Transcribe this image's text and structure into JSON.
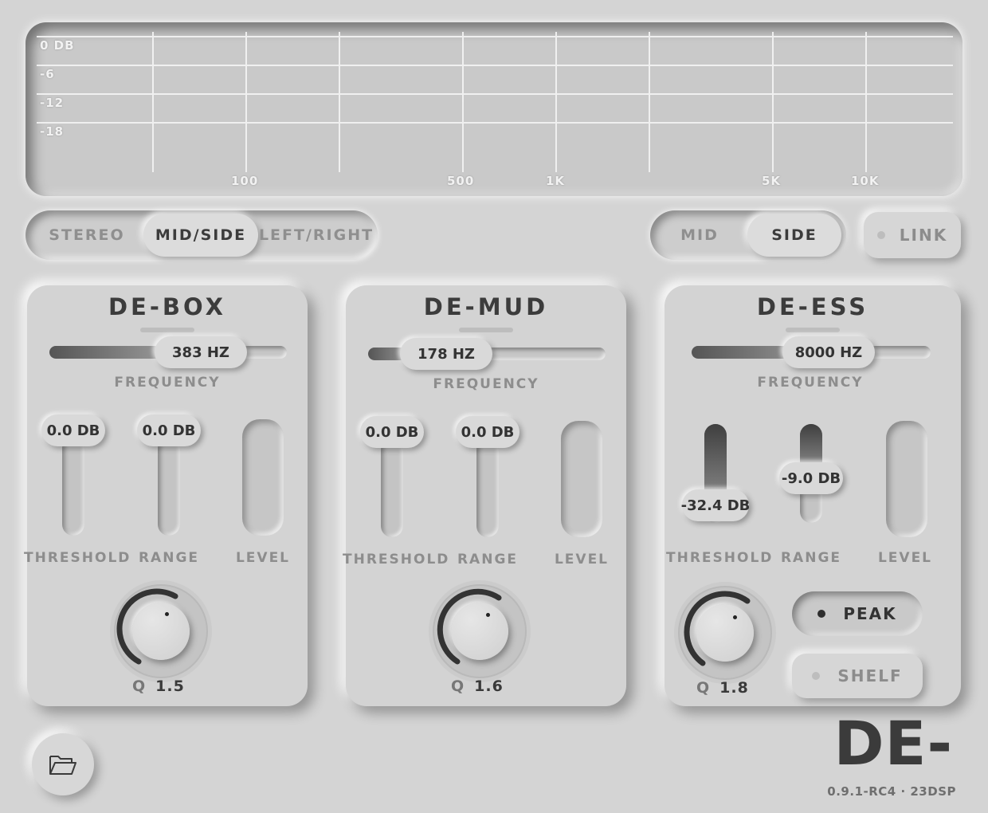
{
  "display": {
    "db_labels": [
      "0 DB",
      "-6",
      "-12",
      "-18"
    ],
    "hz_labels": [
      "100",
      "500",
      "1K",
      "5K",
      "10K"
    ]
  },
  "mode_switch": {
    "options": [
      "STEREO",
      "MID/SIDE",
      "LEFT/RIGHT"
    ],
    "selected": "MID/SIDE"
  },
  "channel_switch": {
    "options": [
      "MID",
      "SIDE"
    ],
    "selected": "SIDE"
  },
  "link": {
    "label": "LINK",
    "active": false
  },
  "modules": [
    {
      "title": "DE-BOX",
      "frequency": {
        "value_label": "383 HZ",
        "label": "FREQUENCY",
        "position": 0.45
      },
      "threshold": {
        "value_label": "0.0 DB",
        "label": "THRESHOLD",
        "level": 0.0
      },
      "range": {
        "value_label": "0.0 DB",
        "label": "RANGE",
        "level": 0.0
      },
      "level_label": "LEVEL",
      "q": {
        "label": "Q",
        "value": "1.5",
        "fraction": 0.5
      }
    },
    {
      "title": "DE-MUD",
      "frequency": {
        "value_label": "178 HZ",
        "label": "FREQUENCY",
        "position": 0.15
      },
      "threshold": {
        "value_label": "0.0 DB",
        "label": "THRESHOLD",
        "level": 0.0
      },
      "range": {
        "value_label": "0.0 DB",
        "label": "RANGE",
        "level": 0.0
      },
      "level_label": "LEVEL",
      "q": {
        "label": "Q",
        "value": "1.6",
        "fraction": 0.55
      }
    },
    {
      "title": "DE-ESS",
      "frequency": {
        "value_label": "8000 HZ",
        "label": "FREQUENCY",
        "position": 0.58
      },
      "threshold": {
        "value_label": "-32.4 DB",
        "label": "THRESHOLD",
        "level": 0.8
      },
      "range": {
        "value_label": "-9.0 DB",
        "label": "RANGE",
        "level": 0.4
      },
      "level_label": "LEVEL",
      "q": {
        "label": "Q",
        "value": "1.8",
        "fraction": 0.6
      },
      "filter_modes": {
        "options": [
          "PEAK",
          "SHELF"
        ],
        "selected": "PEAK"
      }
    }
  ],
  "footer": {
    "open_icon": "folder-open-icon",
    "logo": "DE-",
    "version": "0.9.1-RC4 · 23DSP"
  }
}
